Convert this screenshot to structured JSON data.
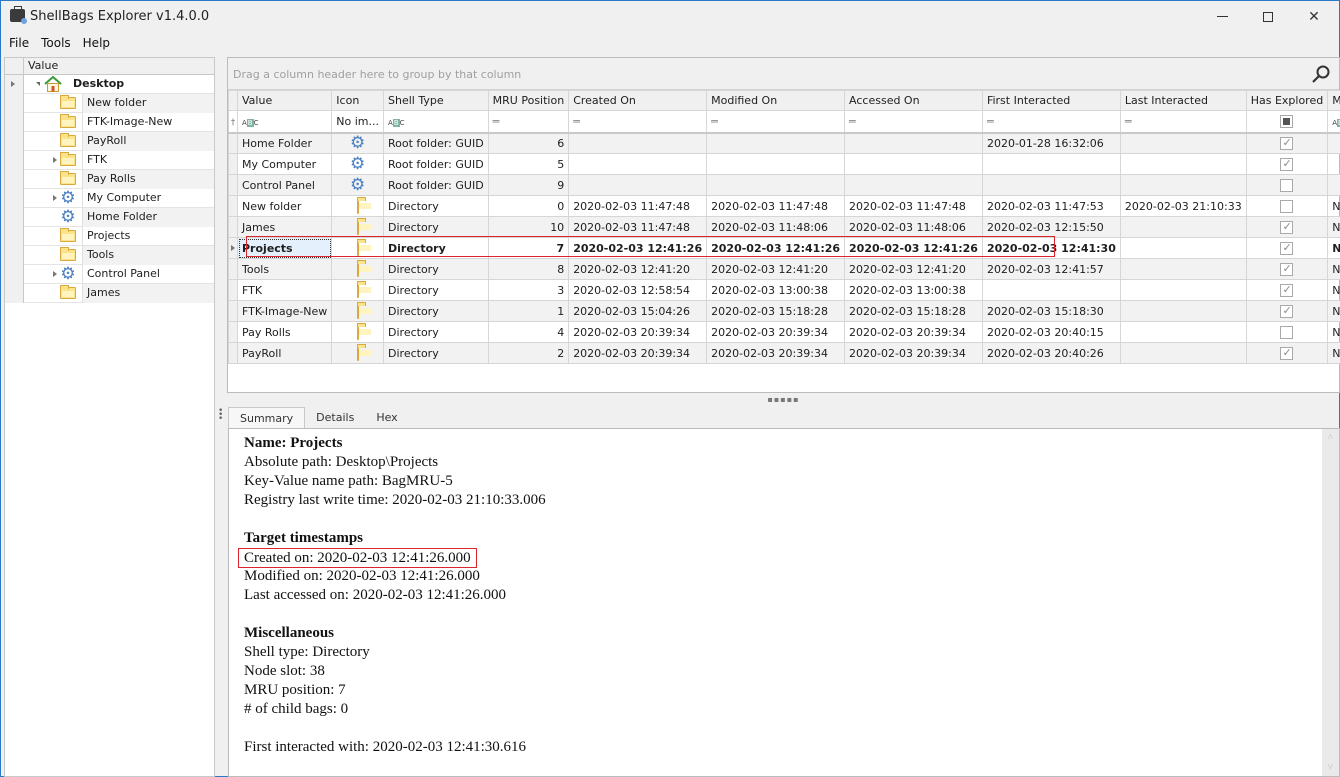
{
  "window": {
    "title": "ShellBags Explorer v1.4.0.0",
    "controls": {
      "minimize": "Minimize",
      "maximize": "Maximize",
      "close": "Close"
    }
  },
  "menu": [
    "File",
    "Tools",
    "Help"
  ],
  "tree": {
    "header": "Value",
    "root": {
      "label": "Desktop",
      "icon": "home-icon"
    },
    "items": [
      {
        "label": "New folder",
        "icon": "folder-icon",
        "expandable": false
      },
      {
        "label": "FTK-Image-New",
        "icon": "folder-icon",
        "expandable": false
      },
      {
        "label": "PayRoll",
        "icon": "folder-icon",
        "expandable": false
      },
      {
        "label": "FTK",
        "icon": "folder-icon",
        "expandable": true
      },
      {
        "label": "Pay Rolls",
        "icon": "folder-icon",
        "expandable": false
      },
      {
        "label": "My Computer",
        "icon": "gear-icon",
        "expandable": true
      },
      {
        "label": "Home Folder",
        "icon": "gear-icon",
        "expandable": false
      },
      {
        "label": "Projects",
        "icon": "folder-icon",
        "expandable": false
      },
      {
        "label": "Tools",
        "icon": "folder-icon",
        "expandable": false
      },
      {
        "label": "Control Panel",
        "icon": "gear-icon",
        "expandable": true
      },
      {
        "label": "James",
        "icon": "folder-icon",
        "expandable": false
      }
    ]
  },
  "grid": {
    "group_panel_text": "Drag a column header here to group by that column",
    "columns": [
      "Value",
      "Icon",
      "Shell Type",
      "MRU Position",
      "Created On",
      "Modified On",
      "Accessed On",
      "First Interacted",
      "Last Interacted",
      "Has Explored",
      "Miscellaneous"
    ],
    "filter_row": {
      "icon_col": "No im..."
    },
    "selected_index": 5,
    "rows": [
      {
        "value": "Home Folder",
        "icon": "gear-icon",
        "shell_type": "Root folder: GUID",
        "mru": "6",
        "created": "",
        "modified": "",
        "accessed": "",
        "first": "2020-01-28 16:32:06",
        "last": "",
        "explored": true,
        "misc": ""
      },
      {
        "value": "My Computer",
        "icon": "gear-icon",
        "shell_type": "Root folder: GUID",
        "mru": "5",
        "created": "",
        "modified": "",
        "accessed": "",
        "first": "",
        "last": "",
        "explored": true,
        "misc": ""
      },
      {
        "value": "Control Panel",
        "icon": "gear-icon",
        "shell_type": "Root folder: GUID",
        "mru": "9",
        "created": "",
        "modified": "",
        "accessed": "",
        "first": "",
        "last": "",
        "explored": false,
        "misc": ""
      },
      {
        "value": "New folder",
        "icon": "folder-icon",
        "shell_type": "Directory",
        "mru": "0",
        "created": "2020-02-03 11:47:48",
        "modified": "2020-02-03 11:47:48",
        "accessed": "2020-02-03 11:47:48",
        "first": "2020-02-03 11:47:53",
        "last": "2020-02-03 21:10:33",
        "explored": false,
        "misc": "NTFS file system"
      },
      {
        "value": "James",
        "icon": "folder-icon",
        "shell_type": "Directory",
        "mru": "10",
        "created": "2020-02-03 11:47:48",
        "modified": "2020-02-03 11:48:06",
        "accessed": "2020-02-03 11:48:06",
        "first": "2020-02-03 12:15:50",
        "last": "",
        "explored": true,
        "misc": "NTFS file system"
      },
      {
        "value": "Projects",
        "icon": "folder-icon",
        "shell_type": "Directory",
        "mru": "7",
        "created": "2020-02-03 12:41:26",
        "modified": "2020-02-03 12:41:26",
        "accessed": "2020-02-03 12:41:26",
        "first": "2020-02-03 12:41:30",
        "last": "",
        "explored": true,
        "misc": "NTFS file sys..."
      },
      {
        "value": "Tools",
        "icon": "folder-icon",
        "shell_type": "Directory",
        "mru": "8",
        "created": "2020-02-03 12:41:20",
        "modified": "2020-02-03 12:41:20",
        "accessed": "2020-02-03 12:41:20",
        "first": "2020-02-03 12:41:57",
        "last": "",
        "explored": true,
        "misc": "NTFS file system"
      },
      {
        "value": "FTK",
        "icon": "folder-icon",
        "shell_type": "Directory",
        "mru": "3",
        "created": "2020-02-03 12:58:54",
        "modified": "2020-02-03 13:00:38",
        "accessed": "2020-02-03 13:00:38",
        "first": "",
        "last": "",
        "explored": true,
        "misc": "NTFS file system"
      },
      {
        "value": "FTK-Image-New",
        "icon": "folder-icon",
        "shell_type": "Directory",
        "mru": "1",
        "created": "2020-02-03 15:04:26",
        "modified": "2020-02-03 15:18:28",
        "accessed": "2020-02-03 15:18:28",
        "first": "2020-02-03 15:18:30",
        "last": "",
        "explored": true,
        "misc": "NTFS file system"
      },
      {
        "value": "Pay Rolls",
        "icon": "folder-icon",
        "shell_type": "Directory",
        "mru": "4",
        "created": "2020-02-03 20:39:34",
        "modified": "2020-02-03 20:39:34",
        "accessed": "2020-02-03 20:39:34",
        "first": "2020-02-03 20:40:15",
        "last": "",
        "explored": false,
        "misc": "NTFS file system"
      },
      {
        "value": "PayRoll",
        "icon": "folder-icon",
        "shell_type": "Directory",
        "mru": "2",
        "created": "2020-02-03 20:39:34",
        "modified": "2020-02-03 20:39:34",
        "accessed": "2020-02-03 20:39:34",
        "first": "2020-02-03 20:40:26",
        "last": "",
        "explored": true,
        "misc": "NTFS file system"
      }
    ]
  },
  "tabs": [
    {
      "label": "Summary",
      "active": true
    },
    {
      "label": "Details",
      "active": false
    },
    {
      "label": "Hex",
      "active": false
    }
  ],
  "summary": {
    "name_line": "Name: Projects",
    "absolute_path": "Absolute path: Desktop\\Projects",
    "key_value_path": "Key-Value name path: BagMRU-5",
    "registry_write": "Registry last write time: 2020-02-03 21:10:33.006",
    "target_heading": "Target timestamps",
    "created_on": "Created on: 2020-02-03 12:41:26.000",
    "modified_on": "Modified on: 2020-02-03 12:41:26.000",
    "accessed_on": "Last accessed on: 2020-02-03 12:41:26.000",
    "misc_heading": "Miscellaneous",
    "shell_type": "Shell type: Directory",
    "node_slot": "Node slot: 38",
    "mru_position": "MRU position: 7",
    "child_bags": "# of child bags: 0",
    "first_interacted": "First interacted with: 2020-02-03 12:41:30.616"
  },
  "colors": {
    "accent_border": "#2b79c8",
    "highlight_red": "#d9252b",
    "gear_blue": "#4a7fc0",
    "folder_yellow": "#fbe38a"
  }
}
